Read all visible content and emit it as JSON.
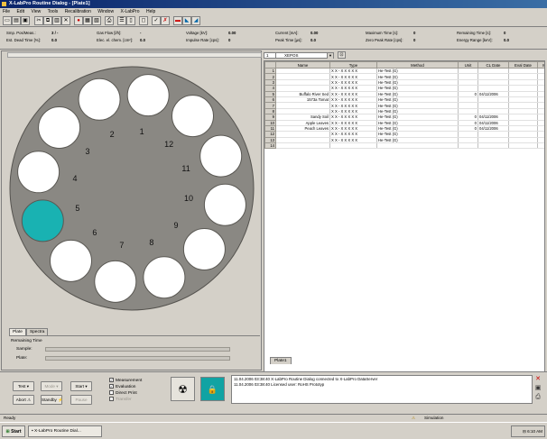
{
  "window": {
    "title": "X-LabPro Routine Dialog - [Plate1]"
  },
  "menu": [
    "File",
    "Edit",
    "View",
    "Tools",
    "Recalibration",
    "Window",
    "X-LabPro",
    "Help"
  ],
  "info": {
    "rows": [
      [
        {
          "label": "Smp. Pos/Meas.:",
          "value": "3 / -"
        },
        {
          "label": "Gas Flow [l/h]:",
          "value": "-"
        },
        {
          "label": "Voltage [kV]:",
          "value": "0.00"
        },
        {
          "label": "Current [mA]:",
          "value": "0.00"
        },
        {
          "label": "Maximum Time [s]:",
          "value": "0"
        },
        {
          "label": "Remaining Time [s]:",
          "value": "0"
        }
      ],
      [
        {
          "label": "Est. Dead Time [%]:",
          "value": "0.0"
        },
        {
          "label": "Elec. el. chem. [cm²]:",
          "value": "0.0"
        },
        {
          "label": "Impulse Rate [cps]:",
          "value": "0"
        },
        {
          "label": "Peak Time [µs]:",
          "value": "0.0"
        },
        {
          "label": "Zero Peak Rate [cps]:",
          "value": "0"
        },
        {
          "label": "Energy Range [keV]:",
          "value": "0.0"
        }
      ]
    ]
  },
  "plate": {
    "positions": [
      "1",
      "2",
      "3",
      "4",
      "5",
      "6",
      "7",
      "8",
      "9",
      "10",
      "11",
      "12"
    ],
    "selected_position": "5",
    "colors": {
      "plate": "#8a8883",
      "well": "#ffffff",
      "selected": "#19b2b2"
    }
  },
  "left_tabs": [
    "Plate",
    "Spectra"
  ],
  "remaining": {
    "title": "Remaining Time",
    "sample_label": "Sample:",
    "plate_label": "Plate:",
    "sample_progress": 0,
    "plate_progress": 0
  },
  "combo": {
    "number": "1",
    "value": "XEPOS"
  },
  "grid": {
    "columns": [
      "",
      "Name",
      "Type",
      "Method",
      "Unit",
      "CL Date",
      "Eval Date",
      "Meas. Ti"
    ],
    "rows": [
      [
        "1",
        "",
        "X X - X X X X X",
        "He-Test (G)",
        "",
        "",
        "",
        ""
      ],
      [
        "2",
        "",
        "X X - X X X X X",
        "He-Test (G)",
        "",
        "",
        "",
        ""
      ],
      [
        "3",
        "",
        "X X - X X X X X",
        "He-Test (G)",
        "",
        "",
        "",
        ""
      ],
      [
        "4",
        "",
        "X X - X X X X X",
        "He-Test (G)",
        "",
        "",
        "",
        ""
      ],
      [
        "5",
        "Buffalo River Sed",
        "X X - X X X X X",
        "He-Test (G)",
        "0",
        "04/11/2006",
        "",
        ""
      ],
      [
        "6",
        "1573a Tomat",
        "X X - X X X X X",
        "He-Test (G)",
        "",
        "",
        "",
        ""
      ],
      [
        "7",
        "",
        "X X - X X X X X",
        "He-Test (G)",
        "",
        "",
        "",
        ""
      ],
      [
        "8",
        "",
        "X X - X X X X X",
        "He-Test (G)",
        "",
        "",
        "",
        ""
      ],
      [
        "9",
        "Sandy Soil",
        "X X - X X X X X",
        "He-Test (G)",
        "0",
        "04/11/2006",
        "",
        ""
      ],
      [
        "10",
        "Apple Leaves",
        "X X - X X X X X",
        "He-Test (G)",
        "0",
        "04/11/2006",
        "",
        ""
      ],
      [
        "11",
        "Peach Leaves",
        "X X - X X X X X",
        "He-Test (G)",
        "0",
        "04/11/2006",
        "",
        ""
      ],
      [
        "12",
        "",
        "X X - X X X X X",
        "He-Test (G)",
        "",
        "",
        "",
        ""
      ],
      [
        "13",
        "",
        "X X - X X X X X",
        "He-Test (G)",
        "",
        "",
        "",
        ""
      ],
      [
        "14",
        "",
        "",
        "",
        "",
        "",
        "",
        ""
      ]
    ]
  },
  "plate_tab": "Plate1",
  "controls": {
    "test": "Test",
    "mode": "Mode",
    "start": "Start",
    "abort": "Abort",
    "standby": "Standby",
    "pause": "Pause"
  },
  "checks": [
    {
      "label": "Measurement",
      "checked": true,
      "enabled": true
    },
    {
      "label": "Evaluation",
      "checked": true,
      "enabled": true
    },
    {
      "label": "Direct Print",
      "checked": false,
      "enabled": true
    },
    {
      "label": "Transfer",
      "checked": true,
      "enabled": false
    }
  ],
  "log": [
    "11.04.2006  03:38:40   X-LabPro Routine Dialog connected to X-LabPro DataServer",
    "11.04.2006  03:38:40   Licensed user: RoHS Prototyp"
  ],
  "status": {
    "left": "Ready",
    "simulation": "Simulation"
  },
  "taskbar": {
    "start": "Start",
    "item": "X-LabPro Routine Dial...",
    "clock": "6:10 AM"
  }
}
